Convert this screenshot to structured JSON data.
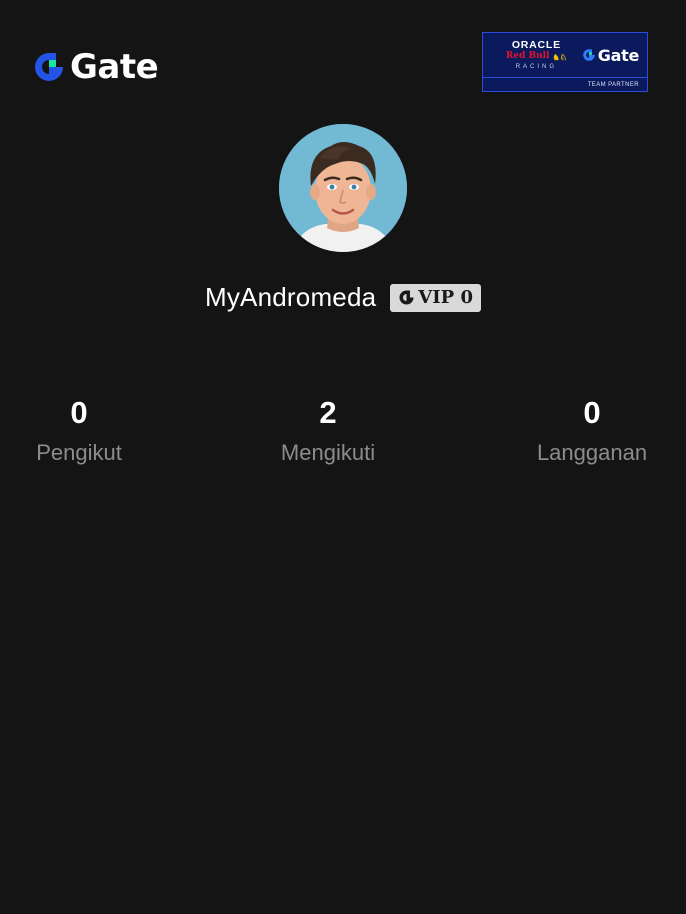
{
  "header": {
    "brand_name": "Gate",
    "partner_badge": {
      "line1": "ORACLE",
      "line2": "Red Bull",
      "line3": "RACING",
      "brand": "Gate",
      "caption": "TEAM PARTNER"
    }
  },
  "profile": {
    "username": "MyAndromeda",
    "vip_label": "VIP 0"
  },
  "stats": [
    {
      "value": "0",
      "label": "Pengikut"
    },
    {
      "value": "2",
      "label": "Mengikuti"
    },
    {
      "value": "0",
      "label": "Langganan"
    }
  ],
  "colors": {
    "background": "#141414",
    "brand_blue": "#2354e6",
    "brand_green": "#17e6a1",
    "muted_text": "#8c8c8c",
    "vip_badge_bg": "#d9d9d9",
    "partner_badge_bg": "#0b1a5c"
  },
  "icons": {
    "logo": "gate-logo-icon",
    "vip": "gate-vip-icon",
    "avatar": "user-avatar-image"
  }
}
